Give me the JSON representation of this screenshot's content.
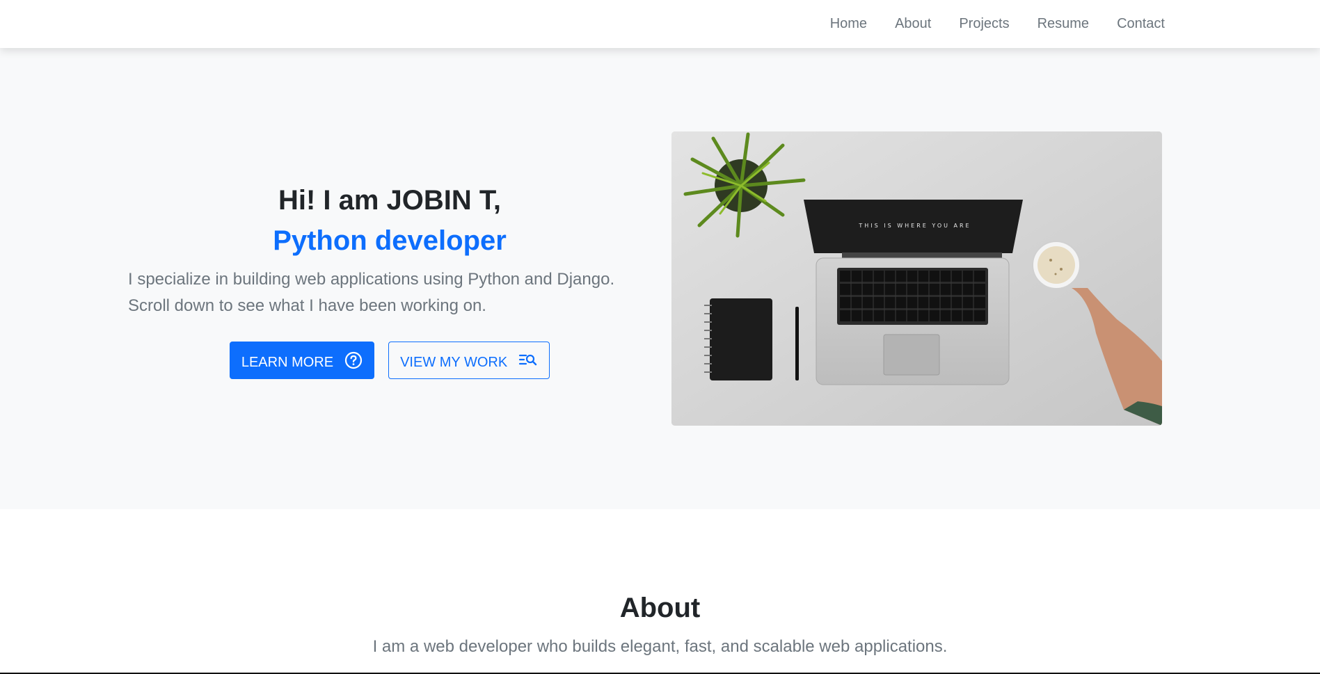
{
  "nav": {
    "items": [
      "Home",
      "About",
      "Projects",
      "Resume",
      "Contact"
    ]
  },
  "hero": {
    "greeting": "Hi! I am JOBIN T,",
    "role": "Python developer",
    "description": "I specialize in building web applications using Python and Django. Scroll down to see what I have been working on.",
    "buttons": {
      "learn_more": "LEARN MORE",
      "learn_more_icon": "question-circle-icon",
      "view_work": "VIEW MY WORK",
      "view_work_icon": "list-search-icon"
    },
    "image_alt": "laptop on desk with plant, notebook, pen and coffee",
    "laptop_screen_text": "THIS IS WHERE YOU ARE"
  },
  "about": {
    "title": "About",
    "text": "I am a web developer who builds elegant, fast, and scalable web applications."
  },
  "colors": {
    "accent": "#0d6efd",
    "muted": "#6c757d",
    "hero_bg": "#f8f9fa"
  }
}
